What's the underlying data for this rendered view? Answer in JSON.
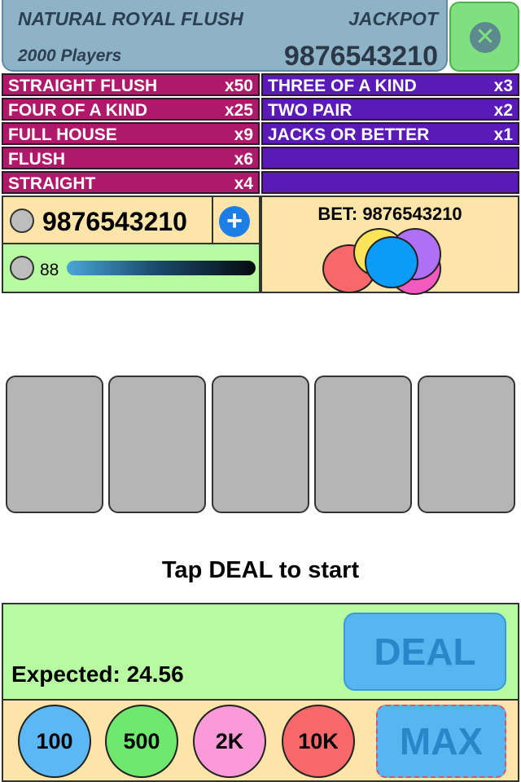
{
  "jackpot": {
    "title": "NATURAL ROYAL FLUSH",
    "label": "JACKPOT",
    "players": "2000 Players",
    "amount": "9876543210"
  },
  "close_icon": "close-icon",
  "paytable": {
    "left": [
      {
        "hand": "STRAIGHT FLUSH",
        "mult": "x50"
      },
      {
        "hand": "FOUR OF A KIND",
        "mult": "x25"
      },
      {
        "hand": "FULL HOUSE",
        "mult": "x9"
      },
      {
        "hand": "FLUSH",
        "mult": "x6"
      },
      {
        "hand": "STRAIGHT",
        "mult": "x4"
      }
    ],
    "right": [
      {
        "hand": "THREE OF A KIND",
        "mult": "x3"
      },
      {
        "hand": "TWO PAIR",
        "mult": "x2"
      },
      {
        "hand": "JACKS OR BETTER",
        "mult": "x1"
      },
      {
        "hand": "",
        "mult": ""
      },
      {
        "hand": "",
        "mult": ""
      }
    ]
  },
  "balance": {
    "value": "9876543210",
    "icon": "coin-icon",
    "add_icon": "plus-icon"
  },
  "level": {
    "value": "88",
    "progress": 1.0
  },
  "bet": {
    "label": "BET: 9876543210",
    "chip_colors": [
      "#f7686a",
      "#fbe45a",
      "#b070f5",
      "#f25ac0",
      "#0a9cf6"
    ]
  },
  "cards": [
    "",
    "",
    "",
    "",
    ""
  ],
  "status": "Tap DEAL to start",
  "expected": "Expected: 24.56",
  "deal_label": "DEAL",
  "bet_chips": [
    {
      "label": "100",
      "color": "#5cb8f4"
    },
    {
      "label": "500",
      "color": "#6ee86e"
    },
    {
      "label": "2K",
      "color": "#fa9ad8"
    },
    {
      "label": "10K",
      "color": "#f7686a"
    }
  ],
  "max_label": "MAX",
  "colors": {
    "paytable_left": "#b0186a",
    "paytable_right": "#5a1ab8",
    "panel_yellow": "#fde4a8",
    "panel_green": "#b8fca2",
    "button_blue": "#56b6f0"
  }
}
